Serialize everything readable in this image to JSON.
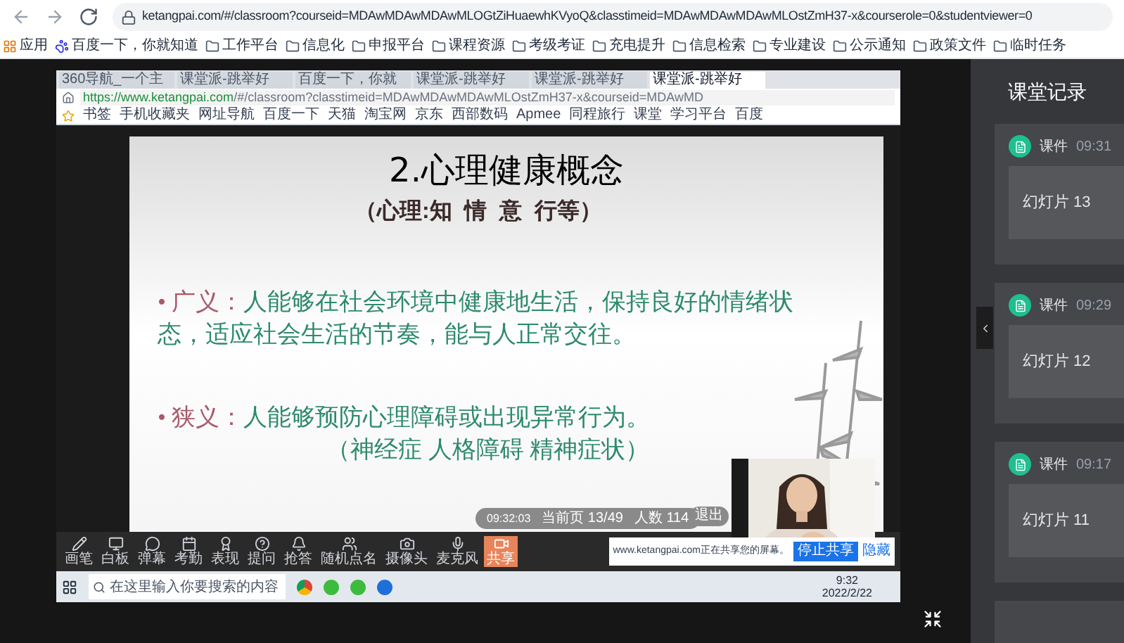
{
  "browser": {
    "url": "ketangpai.com/#/classroom?courseid=MDAwMDAwMDAwMLOGtZiHuaewhKVyoQ&classtimeid=MDAwMDAwMDAwMLOstZmH37-x&courserole=0&studentviewer=0",
    "bookmarks": [
      {
        "kind": "apps",
        "label": "应用"
      },
      {
        "kind": "site",
        "label": "百度一下，你就知道"
      },
      {
        "kind": "folder",
        "label": "工作平台"
      },
      {
        "kind": "folder",
        "label": "信息化"
      },
      {
        "kind": "folder",
        "label": "申报平台"
      },
      {
        "kind": "folder",
        "label": "课程资源"
      },
      {
        "kind": "folder",
        "label": "考级考证"
      },
      {
        "kind": "folder",
        "label": "充电提升"
      },
      {
        "kind": "folder",
        "label": "信息检索"
      },
      {
        "kind": "folder",
        "label": "专业建设"
      },
      {
        "kind": "folder",
        "label": "公示通知"
      },
      {
        "kind": "folder",
        "label": "政策文件"
      },
      {
        "kind": "folder",
        "label": "临时任务"
      }
    ]
  },
  "shared_screen": {
    "tabs": [
      {
        "label": "360导航_一个主",
        "selected": false
      },
      {
        "label": "课堂派-跳举好",
        "selected": false
      },
      {
        "label": "百度一下，你就",
        "selected": false
      },
      {
        "label": "课堂派-跳举好",
        "selected": false
      },
      {
        "label": "课堂派-跳举好",
        "selected": false
      },
      {
        "label": "课堂派-跳举好",
        "selected": true
      }
    ],
    "url_host": "https://www.ketangpai.com",
    "url_path": "/#/classroom?classtimeid=MDAwMDAwMDAwMLOstZmH37-x&courseid=MDAwMD",
    "bookmarks": [
      "书签",
      "手机收藏夹",
      "网址导航",
      "百度一下",
      "天猫",
      "淘宝网",
      "京东",
      "西部数码",
      "Apmee",
      "同程旅行",
      "课堂",
      "学习平台",
      "百度"
    ],
    "slide": {
      "title": "2.心理健康概念",
      "subtitle": "（心理:知  情  意  行等）",
      "bullets": [
        {
          "bullet": "•",
          "term": "广义：",
          "text": "人能够在社会环境中健康地生活，保持良好的情绪状态，适应社会生活的节奏，能与人正常交往。"
        },
        {
          "bullet": "•",
          "term": "狭义：",
          "text": "人能够预防心理障碍或出现异常行为。",
          "note": "（神经症 人格障碍 精神症状）"
        }
      ]
    },
    "status": {
      "clock": "09:32:03",
      "page": "当前页 13/49",
      "people": "人数 114",
      "exit": "退出"
    },
    "toolbar": [
      {
        "kind": "pen",
        "label": "画笔"
      },
      {
        "kind": "board",
        "label": "白板"
      },
      {
        "kind": "danmu",
        "label": "弹幕"
      },
      {
        "kind": "calendar",
        "label": "考勤"
      },
      {
        "kind": "medal",
        "label": "表现"
      },
      {
        "kind": "question",
        "label": "提问"
      },
      {
        "kind": "bell",
        "label": "抢答"
      },
      {
        "kind": "random",
        "label": "随机点名"
      },
      {
        "kind": "camera",
        "label": "摄像头"
      },
      {
        "kind": "mic",
        "label": "麦克风"
      },
      {
        "kind": "share",
        "label": "共享"
      }
    ],
    "share_notice": {
      "text": "www.ketangpai.com正在共享您的屏幕。",
      "stop": "停止共享",
      "hide": "隐藏"
    },
    "taskbar": {
      "search_placeholder": "在这里输入你要搜索的内容",
      "time": "9:32",
      "date": "2022/2/22"
    }
  },
  "panel": {
    "title": "课堂记录",
    "records": [
      {
        "type": "课件",
        "time": "09:31",
        "content": "幻灯片 13"
      },
      {
        "type": "课件",
        "time": "09:29",
        "content": "幻灯片 12"
      },
      {
        "type": "课件",
        "time": "09:17",
        "content": "幻灯片 11"
      }
    ]
  }
}
